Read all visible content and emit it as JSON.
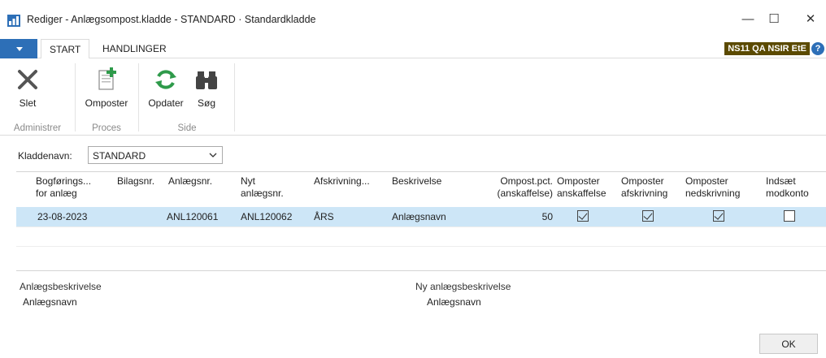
{
  "window": {
    "title": "Rediger - Anlægsompost.kladde - STANDARD · Standardkladde",
    "minimize": "—",
    "maximize": "☐",
    "close": "✕"
  },
  "ribbon_tabs": [
    "START",
    "HANDLINGER"
  ],
  "company": "NS11 QA NSIR EtE",
  "help": "?",
  "ribbon": {
    "buttons": [
      {
        "label": "Slet",
        "icon": "delete-x-icon"
      },
      {
        "label": "Omposter",
        "icon": "repost-document-icon"
      },
      {
        "label": "Opdater",
        "icon": "refresh-icon"
      },
      {
        "label": "Søg",
        "icon": "binoculars-icon"
      }
    ],
    "groups": [
      "Administrer",
      "Proces",
      "Side"
    ]
  },
  "journal": {
    "label": "Kladdenavn:",
    "value": "STANDARD"
  },
  "grid": {
    "headers": [
      "Bogførings... for anlæg",
      "Bilagsnr.",
      "Anlægsnr.",
      "Nyt anlægsnr.",
      "Afskrivning...",
      "Beskrivelse",
      "Ompost.pct. (anskaffelse)",
      "Omposter anskaffelse",
      "Omposter afskrivning",
      "Omposter nedskrivning",
      "Indsæt modkonto"
    ],
    "header_lines": [
      [
        "Bogførings...",
        "for anlæg"
      ],
      [
        "Bilagsnr.",
        ""
      ],
      [
        "Anlægsnr.",
        ""
      ],
      [
        "Nyt",
        "anlægsnr."
      ],
      [
        "Afskrivning...",
        ""
      ],
      [
        "Beskrivelse",
        ""
      ],
      [
        "Ompost.pct.",
        "(anskaffelse)"
      ],
      [
        "Omposter",
        "anskaffelse"
      ],
      [
        "Omposter",
        "afskrivning"
      ],
      [
        "Omposter",
        "nedskrivning"
      ],
      [
        "Indsæt",
        "modkonto"
      ]
    ],
    "rows": [
      {
        "posting_date": "23-08-2023",
        "document_no": "",
        "fa_no": "ANL120061",
        "new_fa_no": "ANL120062",
        "depreciation_book": "ÅRS",
        "description": "Anlægsnavn",
        "pct": "50",
        "repost_acquisition": true,
        "repost_depreciation": true,
        "repost_writedown": true,
        "insert_bal_account": false
      }
    ]
  },
  "footer": {
    "fa_desc_label": "Anlægsbeskrivelse",
    "fa_desc_value": "Anlægsnavn",
    "new_fa_desc_label": "Ny anlægsbeskrivelse",
    "new_fa_desc_value": "Anlægsnavn"
  },
  "ok_button": "OK"
}
